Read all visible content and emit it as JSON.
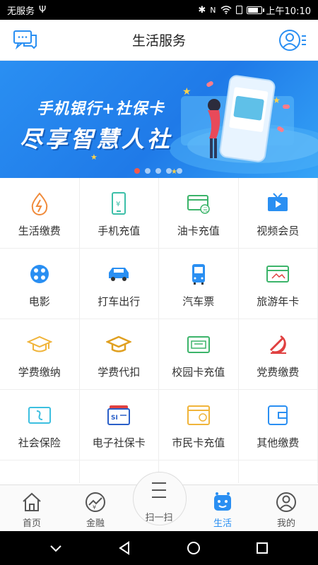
{
  "status_bar": {
    "left": [
      "无服务",
      "Ψ"
    ],
    "right_time": "上午10:10",
    "battery_level": 0.85,
    "icons": [
      "bluetooth-icon",
      "nfc-icon",
      "wifi-icon",
      "sim-icon",
      "battery-icon"
    ]
  },
  "header": {
    "title": "生活服务",
    "left_icon": "chat-icon",
    "right_icon": "user-menu-icon"
  },
  "banner": {
    "line1": "手机银行+社保卡",
    "line2": "尽享智慧人社",
    "slide_count": 5,
    "active_slide": 1,
    "accent_color": "#2a8ff2",
    "active_dot_color": "#f25a4a"
  },
  "services": [
    {
      "label": "生活缴费",
      "icon": "utility-drop-icon",
      "color": "#f08a3a"
    },
    {
      "label": "手机充值",
      "icon": "phone-recharge-icon",
      "color": "#3cbfa8"
    },
    {
      "label": "油卡充值",
      "icon": "fuel-card-icon",
      "color": "#3cb46a"
    },
    {
      "label": "视频会员",
      "icon": "tv-icon",
      "color": "#2a8ff2"
    },
    {
      "label": "电影",
      "icon": "film-reel-icon",
      "color": "#2a8ff2"
    },
    {
      "label": "打车出行",
      "icon": "car-icon",
      "color": "#2a8ff2"
    },
    {
      "label": "汽车票",
      "icon": "bus-icon",
      "color": "#2a8ff2"
    },
    {
      "label": "旅游年卡",
      "icon": "travel-card-icon",
      "color": "#3cb46a"
    },
    {
      "label": "学费缴纳",
      "icon": "graduation-cap-icon",
      "color": "#f0b43a"
    },
    {
      "label": "学费代扣",
      "icon": "graduation-cap-outline-icon",
      "color": "#e0a020"
    },
    {
      "label": "校园卡充值",
      "icon": "campus-card-icon",
      "color": "#3cb46a"
    },
    {
      "label": "党费缴费",
      "icon": "party-emblem-icon",
      "color": "#e04040"
    },
    {
      "label": "社会保险",
      "icon": "insurance-card-icon",
      "color": "#3cbfe0"
    },
    {
      "label": "电子社保卡",
      "icon": "si-card-icon",
      "color": "#2a5fc8"
    },
    {
      "label": "市民卡充值",
      "icon": "citizen-card-icon",
      "color": "#f0b43a"
    },
    {
      "label": "其他缴费",
      "icon": "wallet-icon",
      "color": "#2a8ff2"
    },
    {
      "label": "",
      "icon": "partial-red-icon",
      "color": "#e04040"
    },
    {
      "label": "",
      "icon": "partial-blue-icon",
      "color": "#2a8ff2"
    },
    {
      "label": "",
      "icon": "partial-yellow-icon",
      "color": "#f0b43a"
    },
    {
      "label": "",
      "icon": "partial-dumbbell-icon",
      "color": "#e04040"
    }
  ],
  "tabs": [
    {
      "label": "首页",
      "icon": "home-icon",
      "active": false
    },
    {
      "label": "金融",
      "icon": "finance-icon",
      "active": false
    },
    {
      "label": "扫一扫",
      "icon": "scan-icon",
      "active": false
    },
    {
      "label": "生活",
      "icon": "life-icon",
      "active": true
    },
    {
      "label": "我的",
      "icon": "profile-icon",
      "active": false
    }
  ],
  "nav": [
    "back-icon",
    "home-circle-icon",
    "recents-icon"
  ]
}
